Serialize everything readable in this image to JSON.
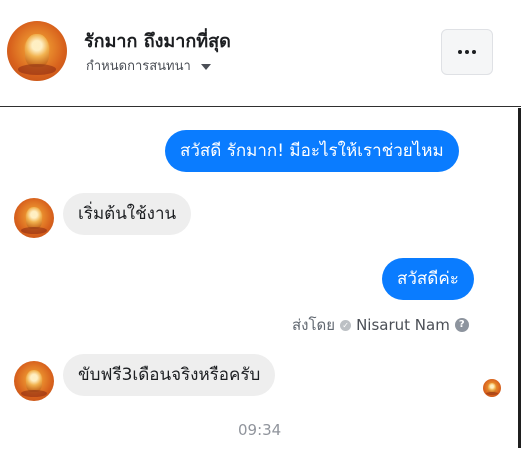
{
  "header": {
    "name": "รักมาก ถึงมากที่สุด",
    "subtitle": "กำหนดการสนทนา",
    "more_label": "···"
  },
  "messages": [
    {
      "direction": "outgoing",
      "text": "สวัสดี รักมาก! มีอะไรให้เราช่วยไหม"
    },
    {
      "direction": "incoming",
      "text": "เริ่มต้นใช้งาน"
    },
    {
      "direction": "outgoing",
      "text": "สวัสดีค่ะ"
    },
    {
      "direction": "incoming",
      "text": "ขับฟรี3เดือนจริงหรือครับ"
    }
  ],
  "sent_by": {
    "prefix": "ส่งโดย",
    "name": "Nisarut Nam",
    "help": "?"
  },
  "timestamp": "09:34",
  "colors": {
    "outgoing_bubble": "#0a7cff",
    "incoming_bubble": "#eeeeee",
    "text_primary": "#1c1e21",
    "text_secondary": "#606770"
  },
  "icons": [
    "avatar-image",
    "chevron-down-icon",
    "more-options-icon",
    "check-circle-icon",
    "help-icon"
  ]
}
